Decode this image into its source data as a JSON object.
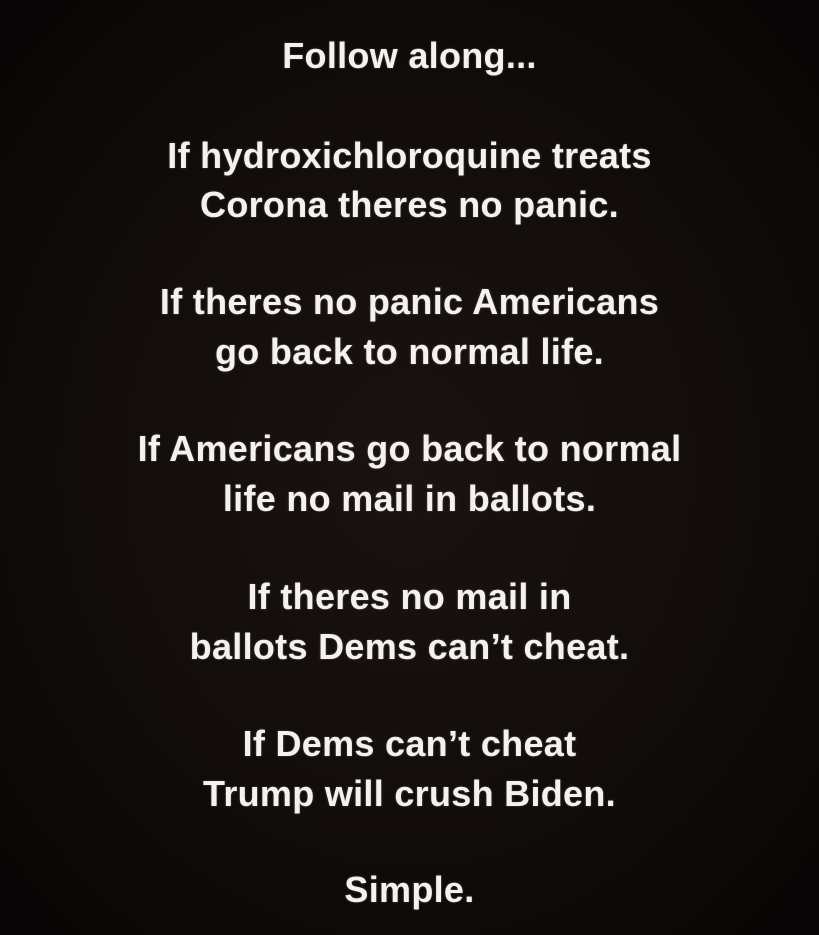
{
  "post": {
    "lines": [
      "Follow along...",
      "If hydroxichloroquine treats",
      "Corona theres no panic.",
      "If theres no panic Americans",
      "go back to normal life.",
      "If Americans go back to normal",
      "life no mail in ballots.",
      "If theres no mail in",
      "ballots Dems can’t cheat.",
      "If Dems can’t cheat",
      "Trump will crush Biden.",
      "Simple."
    ]
  },
  "colors": {
    "background": "#120c0c",
    "text": "#f4f1ef"
  }
}
